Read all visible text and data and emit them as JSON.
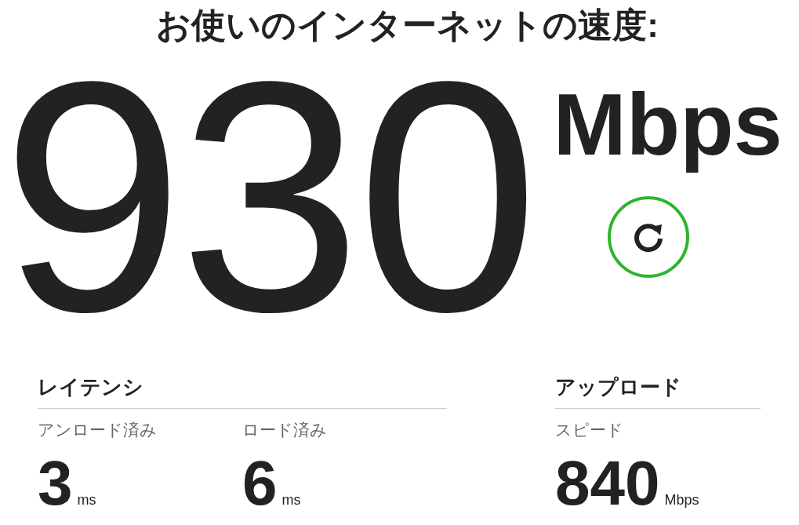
{
  "title": "お使いのインターネットの速度:",
  "speed": {
    "value": "930",
    "unit": "Mbps"
  },
  "latency": {
    "title": "レイテンシ",
    "metrics": [
      {
        "label": "アンロード済み",
        "value": "3",
        "unit": "ms"
      },
      {
        "label": "ロード済み",
        "value": "6",
        "unit": "ms"
      }
    ]
  },
  "upload": {
    "title": "アップロード",
    "metrics": [
      {
        "label": "スピード",
        "value": "840",
        "unit": "Mbps"
      }
    ]
  }
}
